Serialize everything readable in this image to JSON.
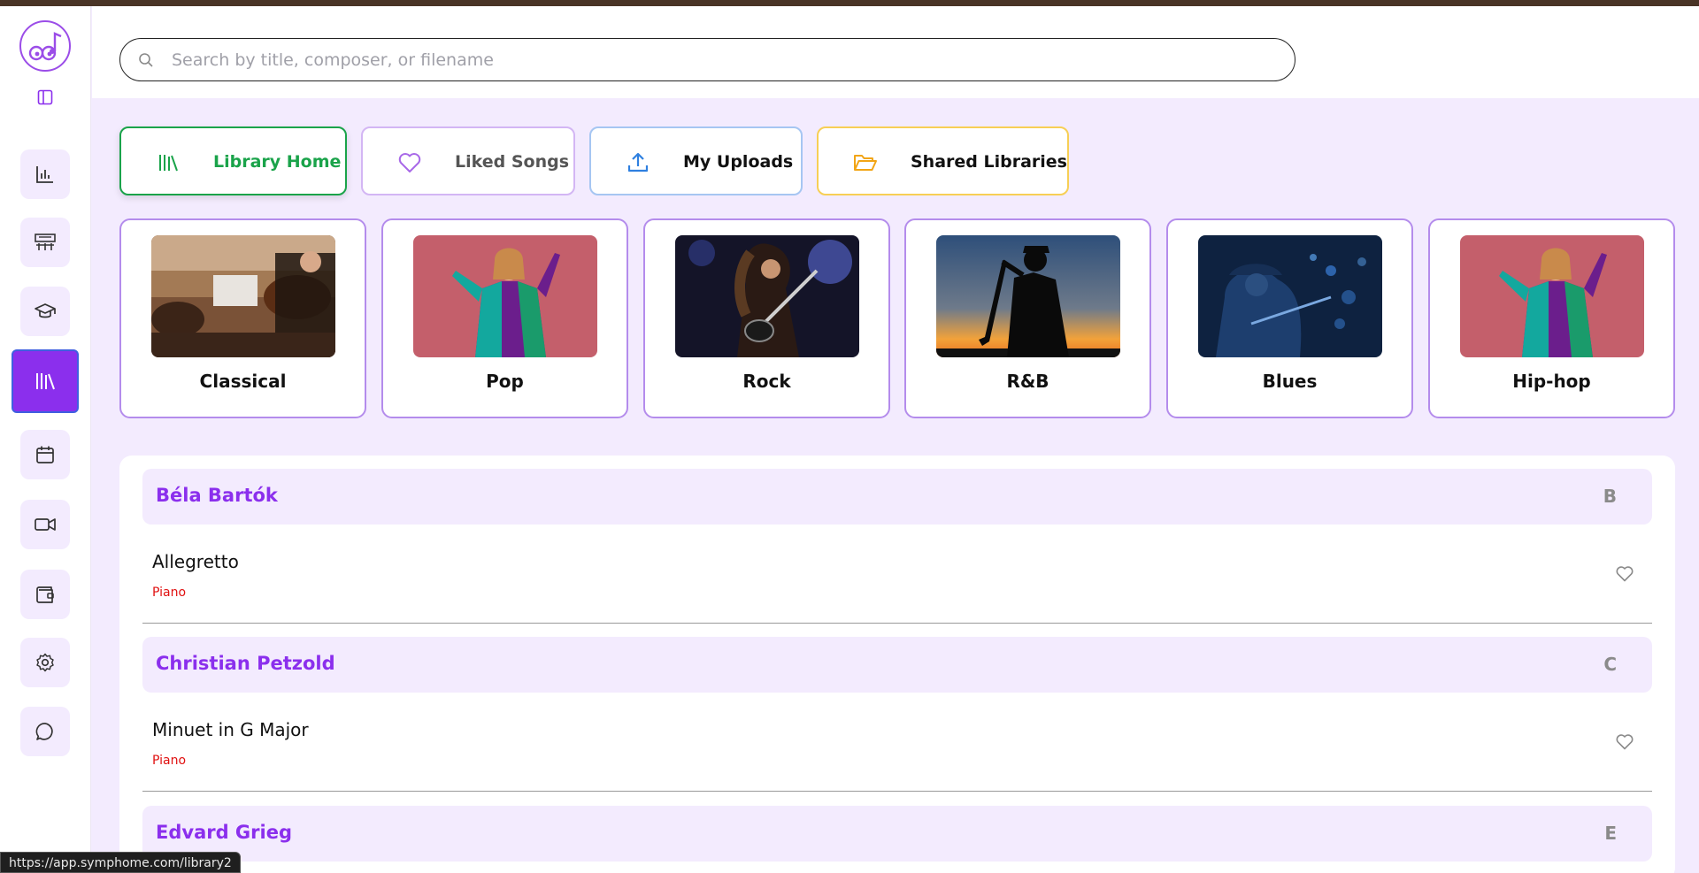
{
  "search": {
    "placeholder": "Search by title, composer, or filename"
  },
  "tabs": [
    {
      "label": "Library Home",
      "color": "#1aa34a"
    },
    {
      "label": "Liked Songs",
      "color": "#c69af0"
    },
    {
      "label": "My Uploads",
      "color": "#8ab5f0"
    },
    {
      "label": "Shared Libraries",
      "color": "#f4c238"
    }
  ],
  "genres": [
    {
      "name": "Classical"
    },
    {
      "name": "Pop"
    },
    {
      "name": "Rock"
    },
    {
      "name": "R&B"
    },
    {
      "name": "Blues"
    },
    {
      "name": "Hip-hop"
    }
  ],
  "library": [
    {
      "composer": "Béla Bartók",
      "letter": "B",
      "song": "Allegretto",
      "instrument": "Piano"
    },
    {
      "composer": "Christian Petzold",
      "letter": "C",
      "song": "Minuet in G Major",
      "instrument": "Piano"
    },
    {
      "composer": "Edvard Grieg",
      "letter": "E"
    }
  ],
  "sidebar": {
    "icons": [
      "dashboard-chart-icon",
      "piano-keys-icon",
      "graduation-cap-icon",
      "library-icon",
      "calendar-icon",
      "video-camera-icon",
      "wallet-icon",
      "settings-gear-icon",
      "chat-bubble-icon"
    ],
    "active_color": "#8b2fed"
  },
  "status_url": "https://app.symphome.com/library2"
}
